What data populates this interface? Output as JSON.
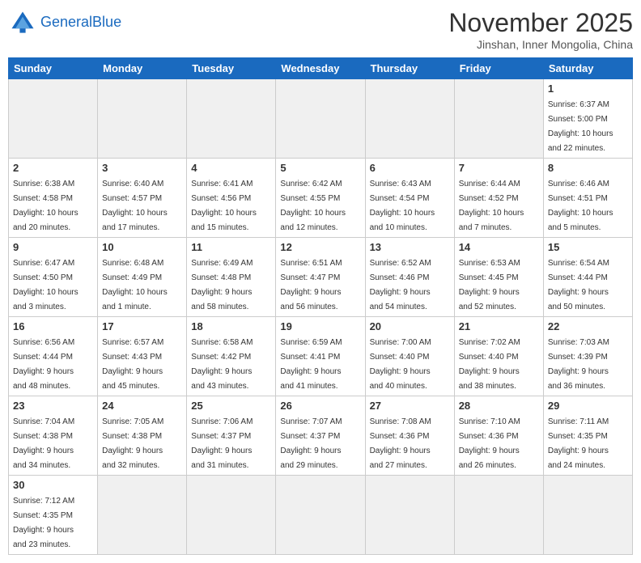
{
  "header": {
    "logo_general": "General",
    "logo_blue": "Blue",
    "month_title": "November 2025",
    "subtitle": "Jinshan, Inner Mongolia, China"
  },
  "weekdays": [
    "Sunday",
    "Monday",
    "Tuesday",
    "Wednesday",
    "Thursday",
    "Friday",
    "Saturday"
  ],
  "days": {
    "d1": {
      "num": "1",
      "info": "Sunrise: 6:37 AM\nSunset: 5:00 PM\nDaylight: 10 hours\nand 22 minutes."
    },
    "d2": {
      "num": "2",
      "info": "Sunrise: 6:38 AM\nSunset: 4:58 PM\nDaylight: 10 hours\nand 20 minutes."
    },
    "d3": {
      "num": "3",
      "info": "Sunrise: 6:40 AM\nSunset: 4:57 PM\nDaylight: 10 hours\nand 17 minutes."
    },
    "d4": {
      "num": "4",
      "info": "Sunrise: 6:41 AM\nSunset: 4:56 PM\nDaylight: 10 hours\nand 15 minutes."
    },
    "d5": {
      "num": "5",
      "info": "Sunrise: 6:42 AM\nSunset: 4:55 PM\nDaylight: 10 hours\nand 12 minutes."
    },
    "d6": {
      "num": "6",
      "info": "Sunrise: 6:43 AM\nSunset: 4:54 PM\nDaylight: 10 hours\nand 10 minutes."
    },
    "d7": {
      "num": "7",
      "info": "Sunrise: 6:44 AM\nSunset: 4:52 PM\nDaylight: 10 hours\nand 7 minutes."
    },
    "d8": {
      "num": "8",
      "info": "Sunrise: 6:46 AM\nSunset: 4:51 PM\nDaylight: 10 hours\nand 5 minutes."
    },
    "d9": {
      "num": "9",
      "info": "Sunrise: 6:47 AM\nSunset: 4:50 PM\nDaylight: 10 hours\nand 3 minutes."
    },
    "d10": {
      "num": "10",
      "info": "Sunrise: 6:48 AM\nSunset: 4:49 PM\nDaylight: 10 hours\nand 1 minute."
    },
    "d11": {
      "num": "11",
      "info": "Sunrise: 6:49 AM\nSunset: 4:48 PM\nDaylight: 9 hours\nand 58 minutes."
    },
    "d12": {
      "num": "12",
      "info": "Sunrise: 6:51 AM\nSunset: 4:47 PM\nDaylight: 9 hours\nand 56 minutes."
    },
    "d13": {
      "num": "13",
      "info": "Sunrise: 6:52 AM\nSunset: 4:46 PM\nDaylight: 9 hours\nand 54 minutes."
    },
    "d14": {
      "num": "14",
      "info": "Sunrise: 6:53 AM\nSunset: 4:45 PM\nDaylight: 9 hours\nand 52 minutes."
    },
    "d15": {
      "num": "15",
      "info": "Sunrise: 6:54 AM\nSunset: 4:44 PM\nDaylight: 9 hours\nand 50 minutes."
    },
    "d16": {
      "num": "16",
      "info": "Sunrise: 6:56 AM\nSunset: 4:44 PM\nDaylight: 9 hours\nand 48 minutes."
    },
    "d17": {
      "num": "17",
      "info": "Sunrise: 6:57 AM\nSunset: 4:43 PM\nDaylight: 9 hours\nand 45 minutes."
    },
    "d18": {
      "num": "18",
      "info": "Sunrise: 6:58 AM\nSunset: 4:42 PM\nDaylight: 9 hours\nand 43 minutes."
    },
    "d19": {
      "num": "19",
      "info": "Sunrise: 6:59 AM\nSunset: 4:41 PM\nDaylight: 9 hours\nand 41 minutes."
    },
    "d20": {
      "num": "20",
      "info": "Sunrise: 7:00 AM\nSunset: 4:40 PM\nDaylight: 9 hours\nand 40 minutes."
    },
    "d21": {
      "num": "21",
      "info": "Sunrise: 7:02 AM\nSunset: 4:40 PM\nDaylight: 9 hours\nand 38 minutes."
    },
    "d22": {
      "num": "22",
      "info": "Sunrise: 7:03 AM\nSunset: 4:39 PM\nDaylight: 9 hours\nand 36 minutes."
    },
    "d23": {
      "num": "23",
      "info": "Sunrise: 7:04 AM\nSunset: 4:38 PM\nDaylight: 9 hours\nand 34 minutes."
    },
    "d24": {
      "num": "24",
      "info": "Sunrise: 7:05 AM\nSunset: 4:38 PM\nDaylight: 9 hours\nand 32 minutes."
    },
    "d25": {
      "num": "25",
      "info": "Sunrise: 7:06 AM\nSunset: 4:37 PM\nDaylight: 9 hours\nand 31 minutes."
    },
    "d26": {
      "num": "26",
      "info": "Sunrise: 7:07 AM\nSunset: 4:37 PM\nDaylight: 9 hours\nand 29 minutes."
    },
    "d27": {
      "num": "27",
      "info": "Sunrise: 7:08 AM\nSunset: 4:36 PM\nDaylight: 9 hours\nand 27 minutes."
    },
    "d28": {
      "num": "28",
      "info": "Sunrise: 7:10 AM\nSunset: 4:36 PM\nDaylight: 9 hours\nand 26 minutes."
    },
    "d29": {
      "num": "29",
      "info": "Sunrise: 7:11 AM\nSunset: 4:35 PM\nDaylight: 9 hours\nand 24 minutes."
    },
    "d30": {
      "num": "30",
      "info": "Sunrise: 7:12 AM\nSunset: 4:35 PM\nDaylight: 9 hours\nand 23 minutes."
    }
  }
}
